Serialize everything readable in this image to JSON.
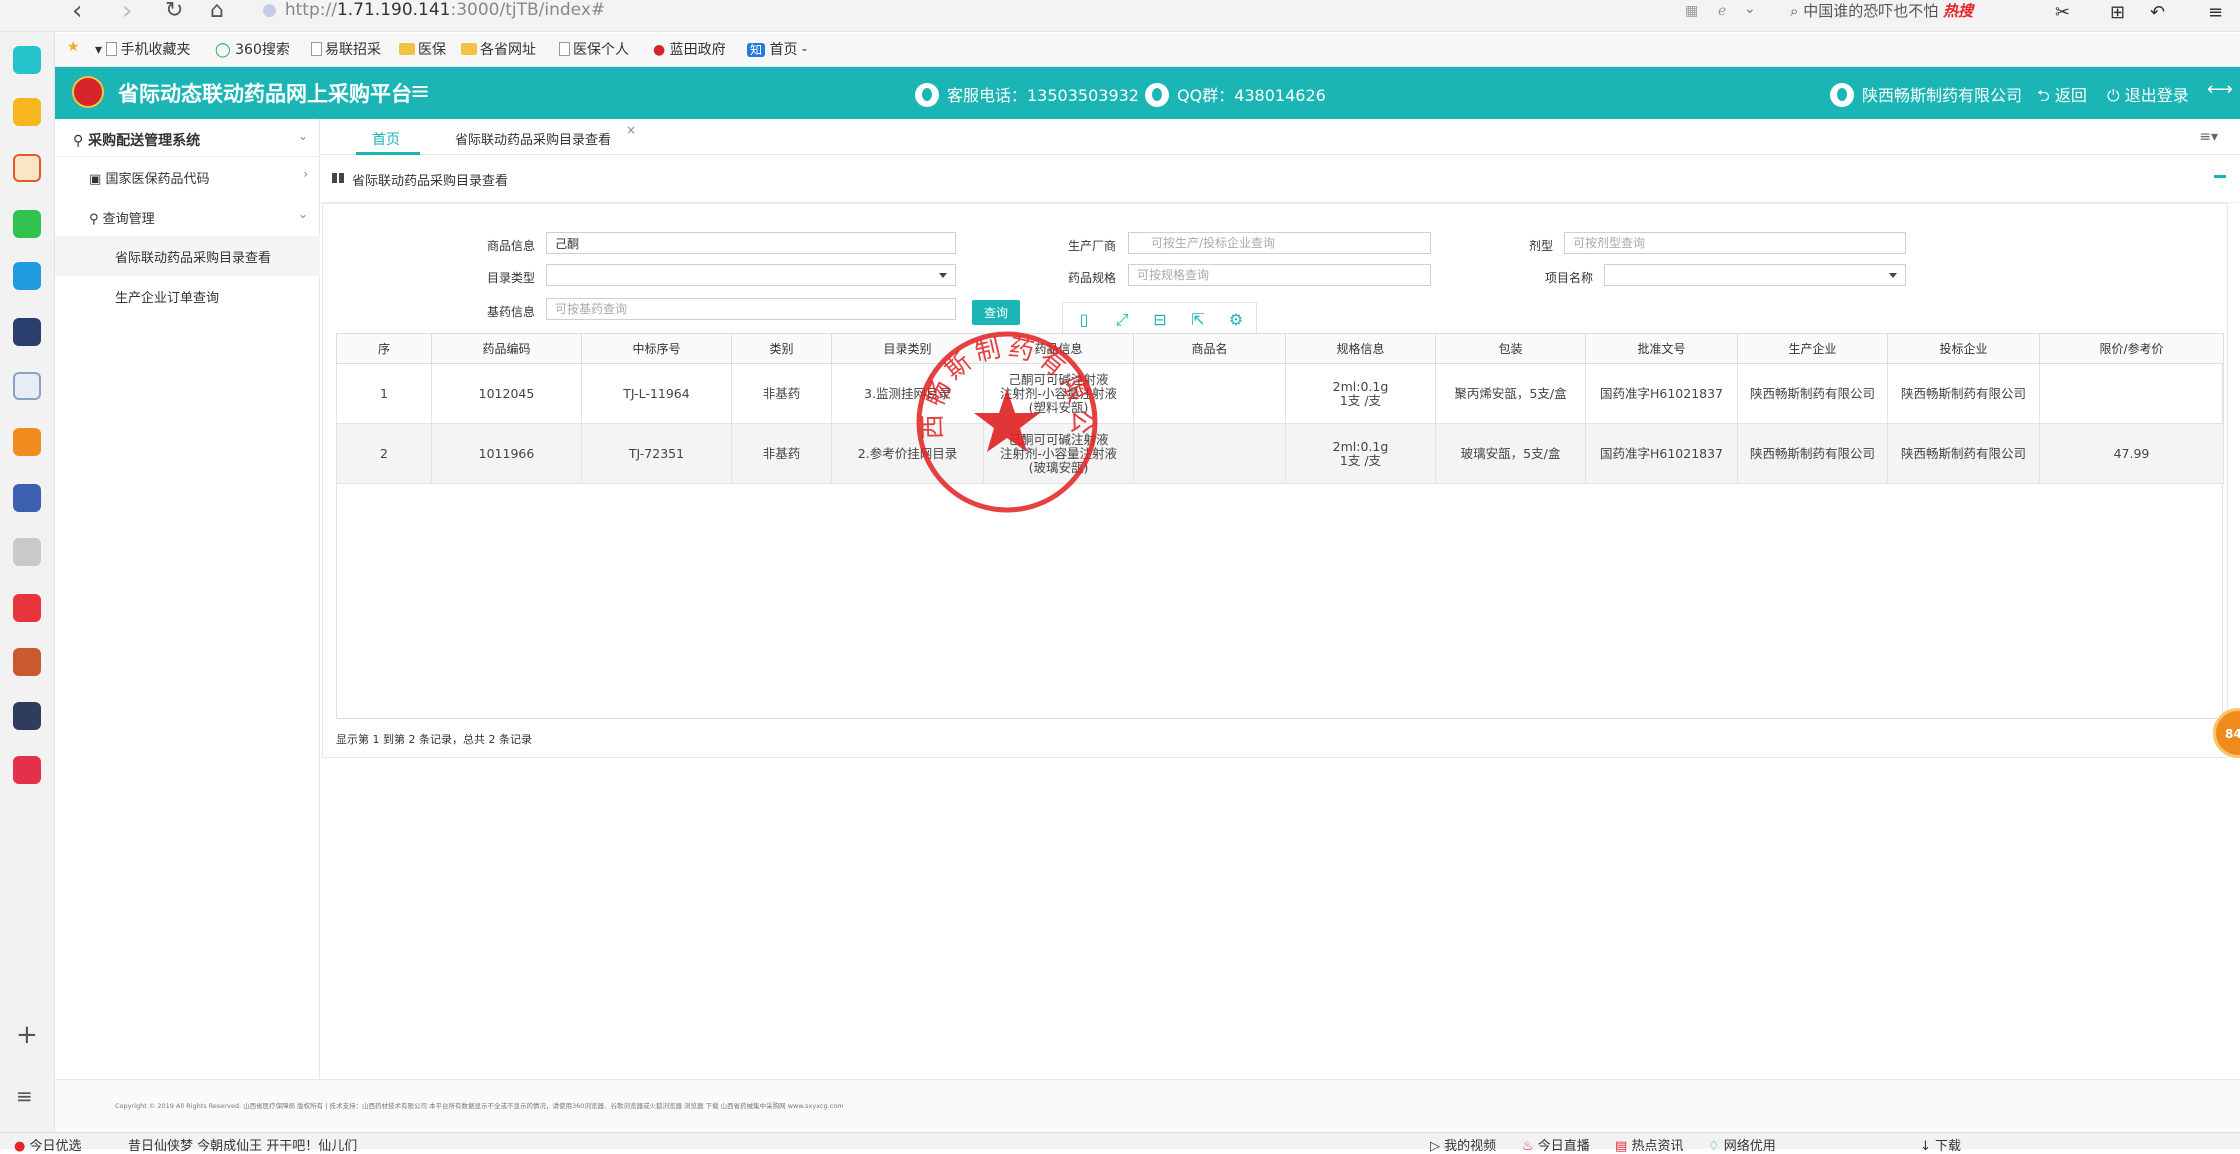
{
  "browser": {
    "url_prefix": "http://",
    "url_host": "1.71.190.141",
    "url_path": ":3000/tjTB/index#",
    "search_text": "中国谁的恐吓也不怕",
    "search_hot": "热搜"
  },
  "bookmarks": [
    {
      "label": "手机收藏夹",
      "type": "phone"
    },
    {
      "label": "360搜索",
      "type": "search"
    },
    {
      "label": "易联招采",
      "type": "page"
    },
    {
      "label": "医保",
      "type": "folder"
    },
    {
      "label": "各省网址",
      "type": "folder"
    },
    {
      "label": "医保个人",
      "type": "page"
    },
    {
      "label": "蓝田政府",
      "type": "emblem"
    },
    {
      "label": "首页 -",
      "type": "zhi"
    }
  ],
  "header": {
    "title": "省际动态联动药品网上采购平台",
    "hotline": "客服电话：13503503932",
    "qq_group": "QQ群：438014626",
    "company": "陕西畅斯制药有限公司",
    "back_label": "返回",
    "logout_label": "退出登录"
  },
  "sidebar": {
    "system": "采购配送管理系统",
    "items": [
      {
        "label": "国家医保药品代码"
      },
      {
        "label": "查询管理"
      },
      {
        "label": "省际联动药品采购目录查看"
      },
      {
        "label": "生产企业订单查询"
      }
    ]
  },
  "tabs": {
    "home": "首页",
    "current": "省际联动药品采购目录查看",
    "close": "×"
  },
  "panel": {
    "title": "省际联动药品采购目录查看"
  },
  "form": {
    "product_info_label": "商品信息",
    "product_info_value": "己酮",
    "catalog_type_label": "目录类型",
    "base_drug_label": "基药信息",
    "base_drug_placeholder": "可按基药查询",
    "manufacturer_label": "生产厂商",
    "manufacturer_placeholder": "可按生产/投标企业查询",
    "spec_label": "药品规格",
    "spec_placeholder": "可按规格查询",
    "dosage_label": "剂型",
    "dosage_placeholder": "可按剂型查询",
    "project_label": "项目名称",
    "query_button": "查询"
  },
  "table": {
    "columns": [
      "序",
      "药品编码",
      "中标序号",
      "类别",
      "目录类别",
      "药品信息",
      "商品名",
      "规格信息",
      "包装",
      "批准文号",
      "生产企业",
      "投标企业",
      "限价/参考价"
    ],
    "rows": [
      {
        "no": "1",
        "code": "1012045",
        "bid_no": "TJ-L-11964",
        "category": "非基药",
        "catalog": "3.监测挂网目录",
        "drug_info_1": "己酮可可碱注射液",
        "drug_info_2": "注射剂-小容量注射液",
        "drug_info_3": "(塑料安瓿)",
        "trade_name": "",
        "spec_1": "2ml:0.1g",
        "spec_2": "1支 /支",
        "package": "聚丙烯安瓿，5支/盒",
        "approval": "国药准字H61021837",
        "manufacturer": "陕西畅斯制药有限公司",
        "bidder": "陕西畅斯制药有限公司",
        "price": ""
      },
      {
        "no": "2",
        "code": "1011966",
        "bid_no": "TJ-72351",
        "category": "非基药",
        "catalog": "2.参考价挂网目录",
        "drug_info_1": "己酮可可碱注射液",
        "drug_info_2": "注射剂-小容量注射液",
        "drug_info_3": "(玻璃安瓿)",
        "trade_name": "",
        "spec_1": "2ml:0.1g",
        "spec_2": "1支 /支",
        "package": "玻璃安瓿，5支/盒",
        "approval": "国药准字H61021837",
        "manufacturer": "陕西畅斯制药有限公司",
        "bidder": "陕西畅斯制药有限公司",
        "price": "47.99"
      }
    ],
    "page_info": "显示第 1 到第 2 条记录，总共 2 条记录"
  },
  "stamp": {
    "text": "陕西畅斯制药有限公司"
  },
  "footer": {
    "text": "Copyright © 2019 All Rights Reserved. 山西省医疗保障局 版权所有  |  技术支持：山西药材技术有限公司      本平台所有数据显示不全或不显示的情况，请使用360浏览器、谷歌浏览器或火狐浏览器  浏览器 下载        山西省药械集中采购网  www.sxyxcg.com"
  },
  "float_badge": "84",
  "status_bar": {
    "left": "今日优选",
    "left2": "昔日仙侠梦 今朝成仙王 开干吧！仙儿们",
    "items": [
      "我的视频",
      "今日直播",
      "热点资讯",
      "网络优用",
      "下载"
    ]
  },
  "colors": {
    "teal": "#1bb5b5",
    "stamp_red": "#e02020"
  }
}
